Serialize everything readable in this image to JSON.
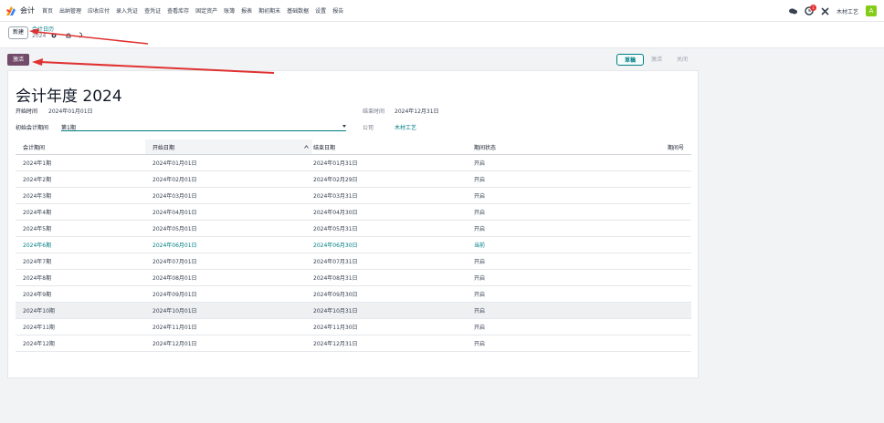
{
  "app": {
    "name": "会计",
    "brand_color": "#714b67",
    "accent_color": "#017e84"
  },
  "navbar": {
    "menu": [
      "首页",
      "出纳管理",
      "应收应付",
      "录入凭证",
      "查凭证",
      "查看库存",
      "固定资产",
      "账簿",
      "报表",
      "期初期末",
      "基础数据",
      "设置",
      "报告"
    ],
    "activity_count": "1",
    "company": "木材工艺",
    "avatar_letter": "A"
  },
  "control_panel": {
    "new_button": "新建",
    "breadcrumb_parent": "会计日历",
    "breadcrumb_current": "2024"
  },
  "statusbar": {
    "activate_button": "激活",
    "stages": [
      "草稿",
      "激活",
      "关闭"
    ],
    "active_stage": "草稿"
  },
  "form": {
    "title": "会计年度 2024",
    "start_label": "开始时间",
    "start_value": "2024年01月01日",
    "end_label": "结束时间",
    "end_value": "2024年12月31日",
    "initial_period_label": "初始会计期间",
    "initial_period_value": "第1期",
    "company_label": "公司",
    "company_value": "木材工艺"
  },
  "table": {
    "columns": [
      "会计期间",
      "开始日期",
      "结束日期",
      "期间状态",
      "期间号"
    ],
    "rows": [
      [
        "2024年1期",
        "2024年01月01日",
        "2024年01月31日",
        "开启",
        ""
      ],
      [
        "2024年2期",
        "2024年02月01日",
        "2024年02月29日",
        "开启",
        ""
      ],
      [
        "2024年3期",
        "2024年03月01日",
        "2024年03月31日",
        "开启",
        ""
      ],
      [
        "2024年4期",
        "2024年04月01日",
        "2024年04月30日",
        "开启",
        ""
      ],
      [
        "2024年5期",
        "2024年05月01日",
        "2024年05月31日",
        "开启",
        ""
      ],
      [
        "2024年6期",
        "2024年06月01日",
        "2024年06月30日",
        "当前",
        ""
      ],
      [
        "2024年7期",
        "2024年07月01日",
        "2024年07月31日",
        "开启",
        ""
      ],
      [
        "2024年8期",
        "2024年08月01日",
        "2024年08月31日",
        "开启",
        ""
      ],
      [
        "2024年9期",
        "2024年09月01日",
        "2024年09月30日",
        "开启",
        ""
      ],
      [
        "2024年10期",
        "2024年10月01日",
        "2024年10月31日",
        "开启",
        ""
      ],
      [
        "2024年11期",
        "2024年11月01日",
        "2024年11月30日",
        "开启",
        ""
      ],
      [
        "2024年12期",
        "2024年12月01日",
        "2024年12月31日",
        "开启",
        ""
      ]
    ],
    "current_row": 5,
    "hover_row": 9
  },
  "annotations": {
    "arrow_color": "#e03131"
  }
}
